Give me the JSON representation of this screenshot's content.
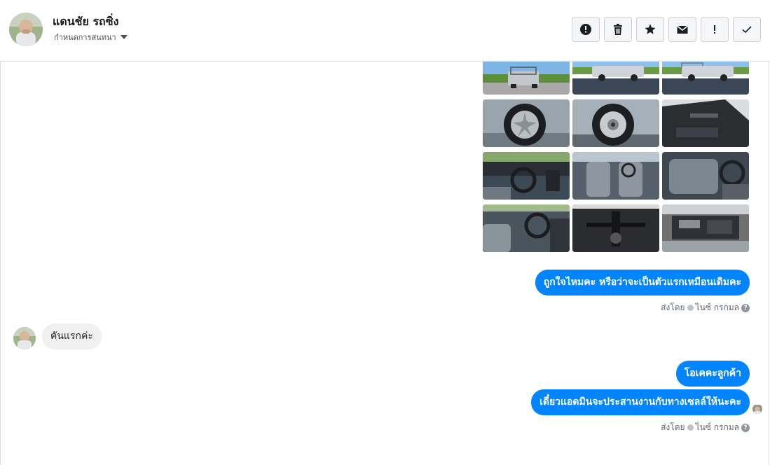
{
  "header": {
    "contact_name": "แดนชัย รถซิ่ง",
    "assign_label": "กำหนดการสนทนา",
    "actions": [
      {
        "icon": "alert-circle-icon",
        "label": "!"
      },
      {
        "icon": "trash-icon",
        "label": ""
      },
      {
        "icon": "star-icon",
        "label": ""
      },
      {
        "icon": "envelope-icon",
        "label": ""
      },
      {
        "icon": "exclamation-icon",
        "label": "!"
      },
      {
        "icon": "check-icon",
        "label": ""
      }
    ]
  },
  "photos": [
    "truck-rear-view-photo",
    "truck-side-view-photo",
    "truck-side-view-photo",
    "alloy-wheel-photo",
    "steel-wheel-photo",
    "door-interior-photo",
    "dashboard-photo",
    "front-seats-photo",
    "rear-seats-photo",
    "steering-wheel-photo",
    "undercarriage-photo",
    "engine-bay-photo"
  ],
  "messages": {
    "outgoing_1": "ถูกใจไหมคะ หรือว่าจะเป็นตัวแรกเหมือนเดิมคะ",
    "sent_by_1": "ส่งโดย",
    "sender_1": "ไนซ์ กรกมล",
    "incoming_1": "คันแรกค่ะ",
    "outgoing_2": "โอเคคะลูกค้า",
    "outgoing_3": "เดี๋ยวแอดมินจะประสานงานกับทางเซลล์ให้นะคะ",
    "sent_by_2": "ส่งโดย",
    "sender_2": "ไนซ์ กรกมล",
    "help_glyph": "?"
  },
  "colors": {
    "accent": "#0084ff",
    "incoming_bubble": "#f1f0f0"
  }
}
